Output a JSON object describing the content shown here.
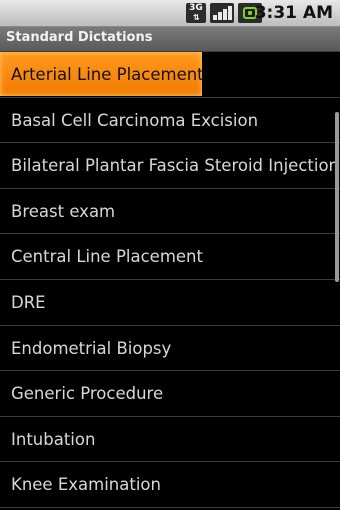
{
  "status_bar": {
    "network_label": "3G",
    "network_icon": "3g-data-icon",
    "signal_icon": "signal-strength-icon",
    "battery_icon": "battery-charging-icon",
    "time": "3:31 AM"
  },
  "title_bar": {
    "title": "Standard Dictations"
  },
  "list": {
    "selected_index": 0,
    "accent_color": "#ff8a00",
    "items": [
      {
        "label": "Arterial Line Placement"
      },
      {
        "label": "Basal Cell Carcinoma Excision"
      },
      {
        "label": "Bilateral Plantar Fascia Steroid Injection"
      },
      {
        "label": "Breast exam"
      },
      {
        "label": "Central Line Placement"
      },
      {
        "label": "DRE"
      },
      {
        "label": "Endometrial Biopsy"
      },
      {
        "label": "Generic Procedure"
      },
      {
        "label": "Intubation"
      },
      {
        "label": "Knee Examination"
      }
    ]
  }
}
